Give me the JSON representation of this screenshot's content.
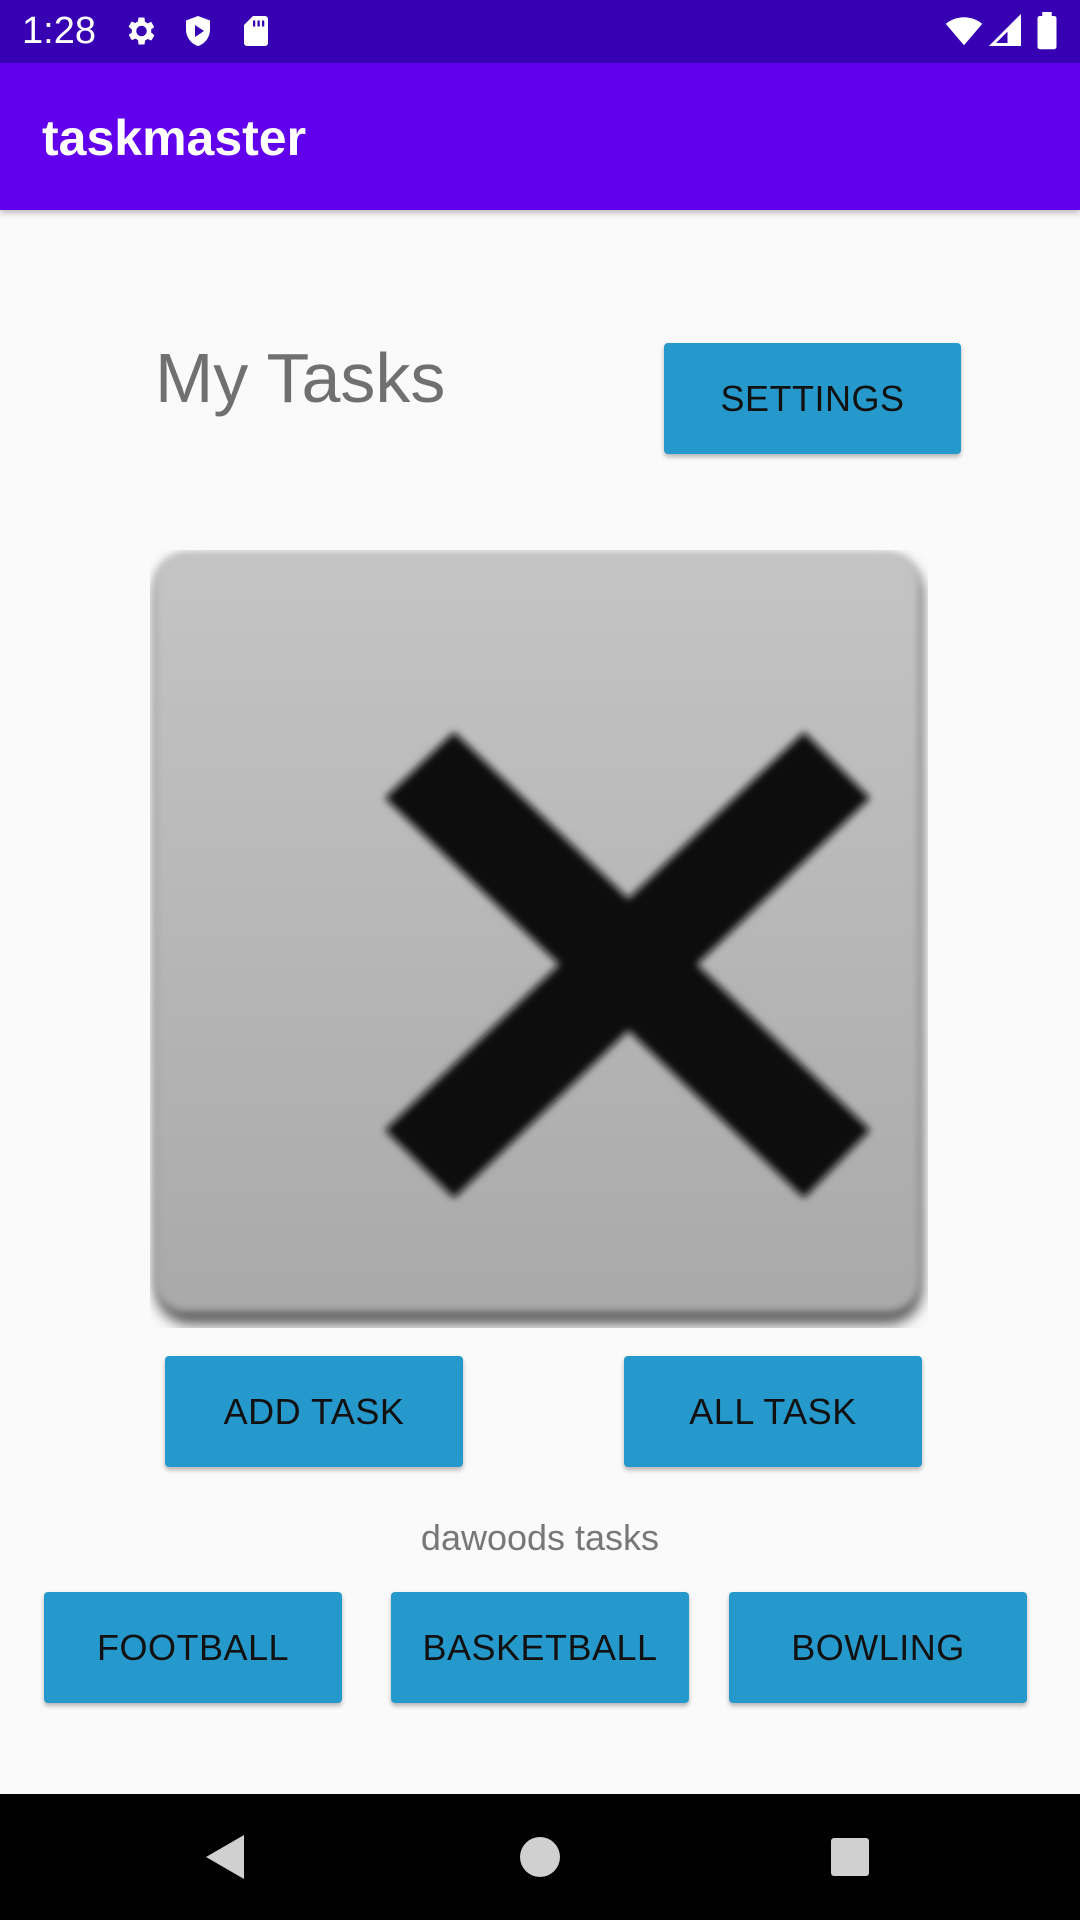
{
  "status_bar": {
    "time": "1:28",
    "icons_left": [
      "gear-icon",
      "shield-play-icon",
      "sd-card-icon"
    ],
    "icons_right": [
      "wifi-icon",
      "signal-icon",
      "battery-icon"
    ],
    "background": "#3700b3"
  },
  "app_bar": {
    "title": "taskmaster",
    "background": "#6200ee"
  },
  "main": {
    "page_title": "My Tasks",
    "settings_label": "SETTINGS",
    "image_icon": "broken-image-x-icon",
    "add_task_label": "ADD TASK",
    "all_task_label": "ALL TASK",
    "caption": "dawoods tasks",
    "task_buttons": [
      "FOOTBALL",
      "BASKETBALL",
      "BOWLING"
    ],
    "button_color": "#2699cc"
  },
  "nav_bar": {
    "icons": [
      "back-icon",
      "home-icon",
      "recents-icon"
    ]
  }
}
